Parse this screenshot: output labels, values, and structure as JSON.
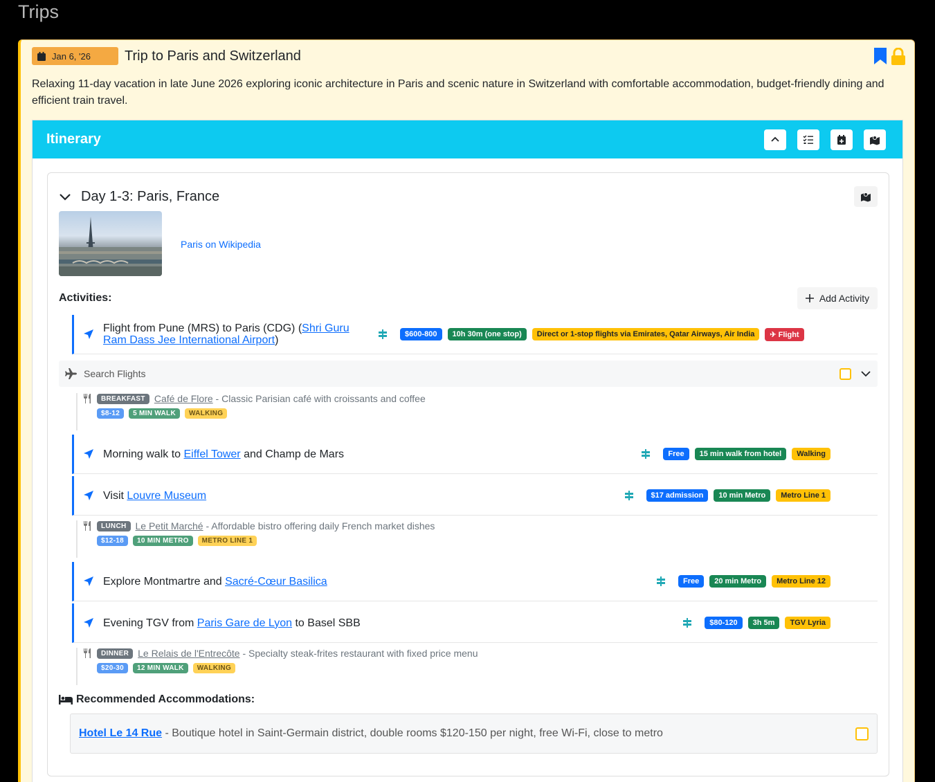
{
  "page": {
    "title": "Trips"
  },
  "trip": {
    "date": "Jan 6, '26",
    "title": "Trip to Paris and Switzerland",
    "description": "Relaxing 11-day vacation in late June 2026 exploring iconic architecture in Paris and scenic nature in Switzerland with comfortable accommodation, budget-friendly dining and efficient train travel."
  },
  "itinerary": {
    "title": "Itinerary",
    "tools": [
      "chevron-up-icon",
      "checklist-icon",
      "calendar-plus-icon",
      "map-icon"
    ]
  },
  "day": {
    "title": "Day 1-3: Paris, France",
    "wiki_link": "Paris on Wikipedia",
    "activities_label": "Activities:",
    "add_activity_label": "Add Activity",
    "activities": [
      {
        "pre": "Flight from Pune (MRS) to Paris (CDG) (",
        "link": "Shri Guru Ram Dass Jee International Airport",
        "post": ")",
        "badges": [
          {
            "text": "$600-800",
            "color": "blue"
          },
          {
            "text": "10h 30m (one stop)",
            "color": "green"
          },
          {
            "text": "Direct or 1-stop flights via Emirates, Qatar Airways, Air India",
            "color": "yellow"
          },
          {
            "text": "Flight",
            "color": "red"
          }
        ]
      },
      {
        "pre": "Morning walk to ",
        "link": "Eiffel Tower",
        "post": " and Champ de Mars",
        "badges": [
          {
            "text": "Free",
            "color": "blue"
          },
          {
            "text": "15 min walk from hotel",
            "color": "green"
          },
          {
            "text": "Walking",
            "color": "yellow"
          }
        ]
      },
      {
        "pre": "Visit ",
        "link": "Louvre Museum",
        "post": "",
        "badges": [
          {
            "text": "$17 admission",
            "color": "blue"
          },
          {
            "text": "10 min Metro",
            "color": "green"
          },
          {
            "text": "Metro Line 1",
            "color": "yellow"
          }
        ]
      },
      {
        "pre": "Explore Montmartre and ",
        "link": "Sacré-Cœur Basilica",
        "post": "",
        "badges": [
          {
            "text": "Free",
            "color": "blue"
          },
          {
            "text": "20 min Metro",
            "color": "green"
          },
          {
            "text": "Metro Line 12",
            "color": "yellow"
          }
        ]
      },
      {
        "pre": "Evening TGV from ",
        "link": "Paris Gare de Lyon",
        "post": " to Basel SBB",
        "badges": [
          {
            "text": "$80-120",
            "color": "blue"
          },
          {
            "text": "3h 5m",
            "color": "green"
          },
          {
            "text": "TGV Lyria",
            "color": "yellow"
          }
        ]
      }
    ],
    "search_flights_label": "Search Flights",
    "meals": [
      {
        "type": "BREAKFAST",
        "name": "Café de Flore",
        "desc": " - Classic Parisian café with croissants and coffee",
        "badges": [
          "$8-12",
          "5 MIN WALK",
          "WALKING"
        ]
      },
      {
        "type": "LUNCH",
        "name": "Le Petit Marché",
        "desc": " - Affordable bistro offering daily French market dishes",
        "badges": [
          "$12-18",
          "10 MIN METRO",
          "METRO LINE 1"
        ]
      },
      {
        "type": "DINNER",
        "name": "Le Relais de l'Entrecôte",
        "desc": " - Specialty steak-frites restaurant with fixed price menu",
        "badges": [
          "$20-30",
          "12 MIN WALK",
          "WALKING"
        ]
      }
    ],
    "accommodations_label": "Recommended Accommodations:",
    "accommodation": {
      "name": "Hotel Le 14 Rue",
      "desc": " - Boutique hotel in Saint-Germain district, double rooms $120-150 per night, free Wi-Fi, close to metro"
    }
  },
  "colors": {
    "accent": "#0dcaf0",
    "card_bg": "#fff8dd",
    "card_border": "#ffc107",
    "link": "#0d6efd"
  }
}
